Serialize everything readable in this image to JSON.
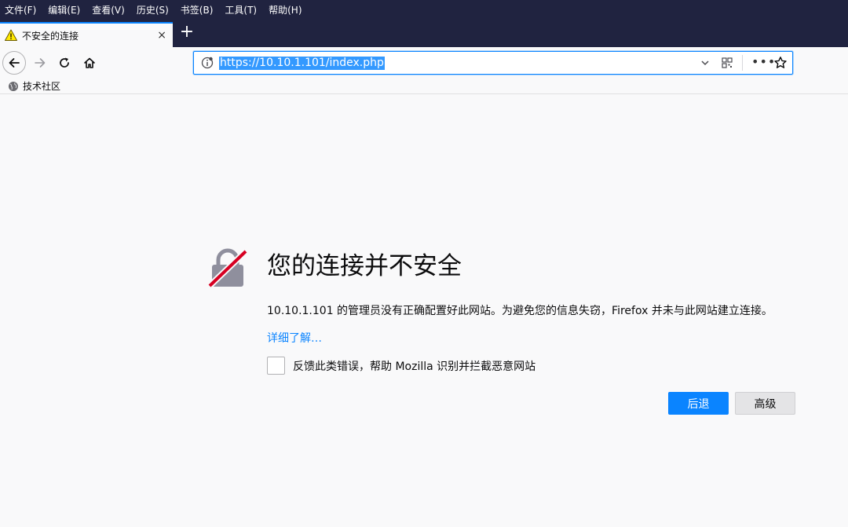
{
  "menubar": {
    "items": [
      {
        "label": "文件(F)"
      },
      {
        "label": "编辑(E)"
      },
      {
        "label": "查看(V)"
      },
      {
        "label": "历史(S)"
      },
      {
        "label": "书签(B)"
      },
      {
        "label": "工具(T)"
      },
      {
        "label": "帮助(H)"
      }
    ]
  },
  "tab": {
    "title": "不安全的连接",
    "close_icon": "×",
    "new_tab_icon": "+"
  },
  "urlbar": {
    "url": "https://10.10.1.101/index.php",
    "more_icon": "•••"
  },
  "bookmarks": {
    "items": [
      {
        "label": "技术社区"
      }
    ]
  },
  "error": {
    "title": "您的连接并不安全",
    "description": "10.10.1.101 的管理员没有正确配置好此网站。为避免您的信息失窃，Firefox 并未与此网站建立连接。",
    "learn_more": "详细了解…",
    "report_label": "反馈此类错误，帮助 Mozilla 识别并拦截恶意网站",
    "back_button": "后退",
    "advanced_button": "高级"
  },
  "colors": {
    "chrome_dark": "#202340",
    "accent": "#0a84ff",
    "warning": "#ffe900",
    "lock_gray": "#8f8f9d",
    "lock_red": "#d70022"
  }
}
